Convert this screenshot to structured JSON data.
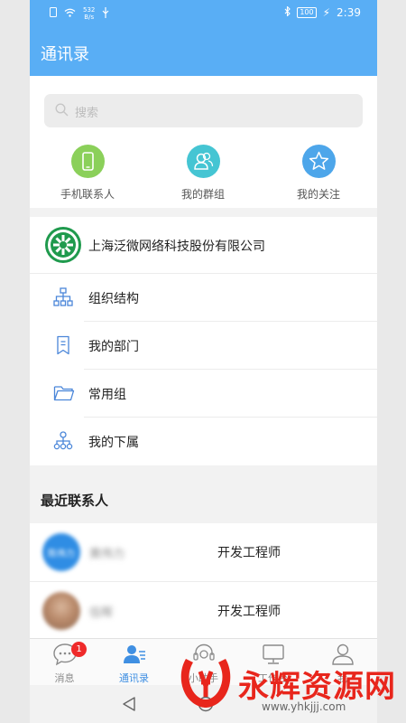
{
  "status_bar": {
    "net_speed": "532\nB/s",
    "battery": "100",
    "time": "2:39"
  },
  "header": {
    "title": "通讯录"
  },
  "search": {
    "placeholder": "搜索"
  },
  "quick_actions": [
    {
      "label": "手机联系人",
      "icon": "phone-icon",
      "color": "#8bd05a"
    },
    {
      "label": "我的群组",
      "icon": "group-icon",
      "color": "#45c5d3"
    },
    {
      "label": "我的关注",
      "icon": "star-icon",
      "color": "#4da6ea"
    }
  ],
  "company": {
    "name": "上海泛微网络科技股份有限公司"
  },
  "menu": [
    {
      "label": "组织结构",
      "icon": "org-chart-icon"
    },
    {
      "label": "我的部门",
      "icon": "bookmark-icon"
    },
    {
      "label": "常用组",
      "icon": "folder-icon"
    },
    {
      "label": "我的下属",
      "icon": "subordinates-icon"
    }
  ],
  "recent": {
    "title": "最近联系人",
    "contacts": [
      {
        "avatar_text": "陈伟力",
        "name": "黄伟力",
        "role": "开发工程师"
      },
      {
        "avatar_text": "",
        "name": "伍晖",
        "role": "开发工程师"
      }
    ]
  },
  "tabs": [
    {
      "label": "消息",
      "badge": "1"
    },
    {
      "label": "通讯录"
    },
    {
      "label": "小助手"
    },
    {
      "label": "工作台"
    },
    {
      "label": "我"
    }
  ],
  "watermark": {
    "text": "永辉资源网",
    "url": "www.yhkjjj.com"
  },
  "colors": {
    "accent": "#59aef5",
    "active_tab": "#3f8fe2",
    "badge": "#ef2a2a"
  }
}
